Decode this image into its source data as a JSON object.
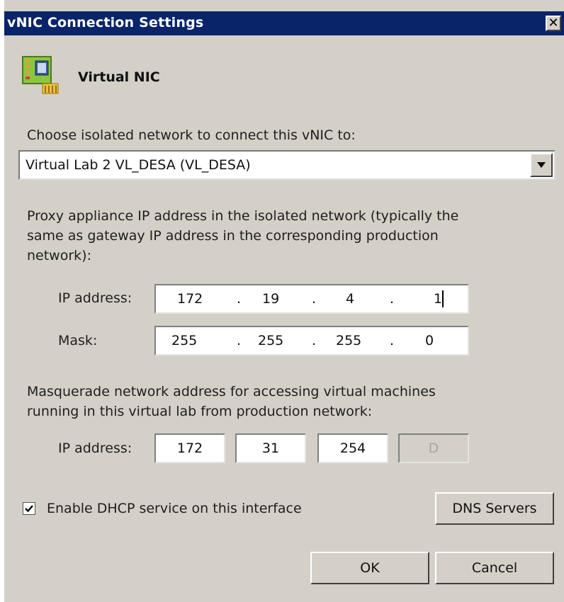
{
  "window": {
    "title": "vNIC Connection Settings",
    "close_glyph": "✕"
  },
  "header": {
    "title": "Virtual NIC",
    "icon": "network-card-icon"
  },
  "network": {
    "label": "Choose isolated network to connect this vNIC to:",
    "selected": "Virtual Lab 2 VL_DESA (VL_DESA)"
  },
  "proxy": {
    "description_line1": "Proxy appliance IP address in the isolated network (typically the",
    "description_line2": "same as gateway IP address in the corresponding production",
    "description_line3": "network):",
    "ip_label": "IP address:",
    "ip": [
      "172",
      "19",
      "4",
      "1"
    ],
    "mask_label": "Mask:",
    "mask": [
      "255",
      "255",
      "255",
      "0"
    ],
    "separator": "."
  },
  "masquerade": {
    "description_line1": "Masquerade network address for accessing virtual machines",
    "description_line2": "running in this virtual lab from production network:",
    "ip_label": "IP address:",
    "ip": [
      "172",
      "31",
      "254",
      "D"
    ]
  },
  "dhcp": {
    "label": "Enable DHCP service on this interface",
    "checked": true
  },
  "buttons": {
    "dns": "DNS Servers",
    "ok": "OK",
    "cancel": "Cancel"
  },
  "colors": {
    "titlebar": "#0a246a",
    "dialog_bg": "#d4d0c8"
  }
}
